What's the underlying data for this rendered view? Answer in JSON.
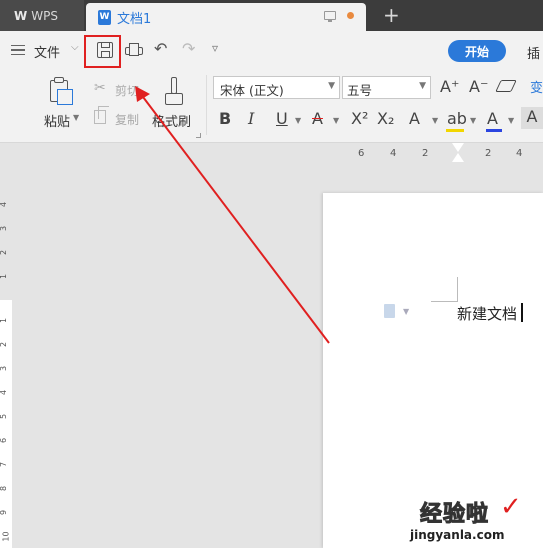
{
  "titlebar": {
    "app_label": "WPS",
    "doc_tab": "文档1"
  },
  "menu": {
    "file": "文件",
    "start_tab": "开始",
    "insert_tab": "插"
  },
  "ribbon": {
    "paste": "粘贴",
    "cut": "剪切",
    "copy": "复制",
    "format_painter": "格式刷",
    "font_name": "宋体 (正文)",
    "font_size": "五号"
  },
  "ruler": {
    "h_numbers": [
      "6",
      "4",
      "2",
      "2",
      "4"
    ],
    "v_numbers": [
      "4",
      "3",
      "2",
      "1",
      "1",
      "2",
      "3",
      "4",
      "5",
      "6",
      "7",
      "8",
      "9",
      "10"
    ]
  },
  "document": {
    "text": "新建文档"
  },
  "watermark": {
    "title": "经验啦",
    "check": "✓",
    "url": "jingyanla.com"
  },
  "colors": {
    "accent": "#2b79d9",
    "annotation": "#e02020",
    "titlebar": "#3c3c3c"
  }
}
